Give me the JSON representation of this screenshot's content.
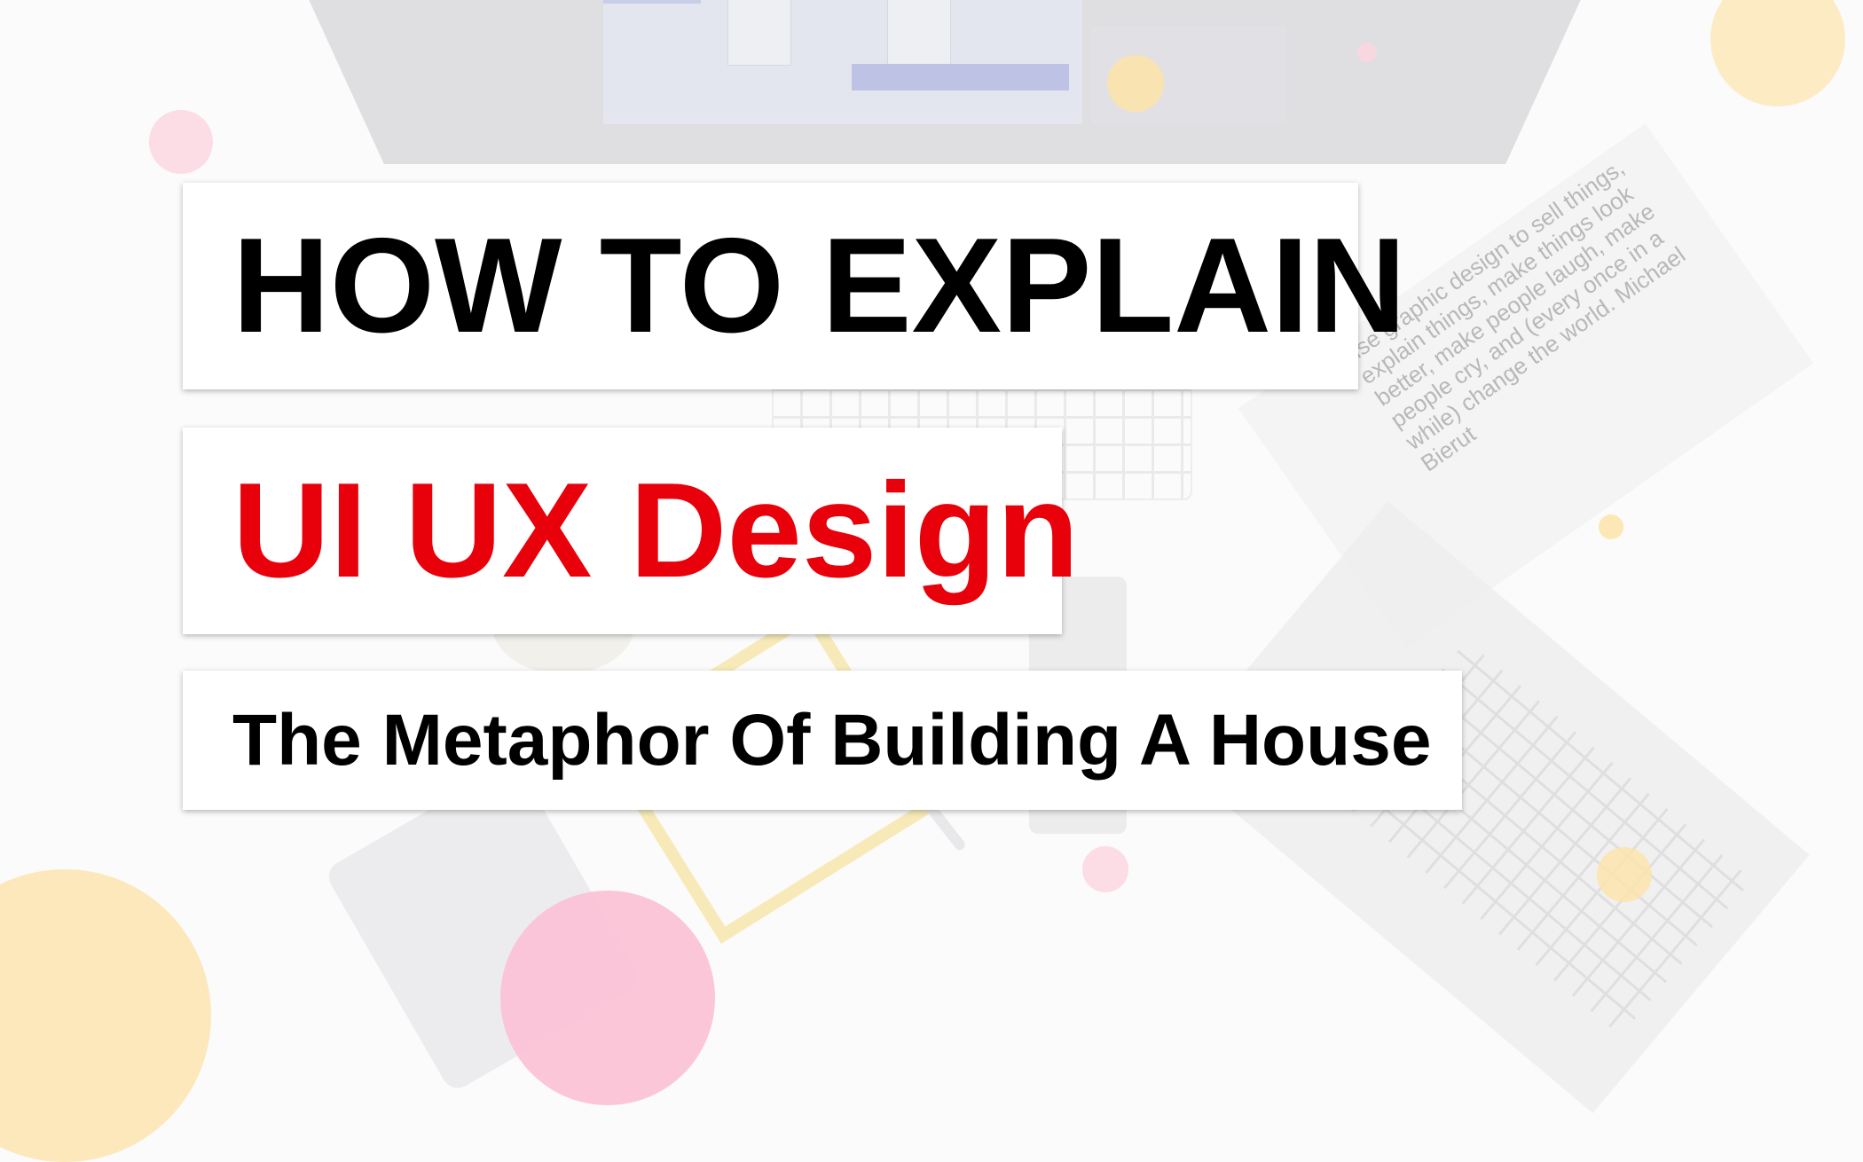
{
  "headline": {
    "line1": "HOW TO EXPLAIN",
    "line2": "UI UX Design",
    "subtitle": "The Metaphor Of Building A House"
  },
  "background": {
    "book_text": "use graphic design to sell things, explain things, make things look better, make people laugh, make people cry, and (every once in a while) change the world. Michael Bierut"
  },
  "colors": {
    "accent_red": "#e8000b",
    "text_black": "#000000",
    "box_white": "#ffffff",
    "dot_pink": "#fbc3d6",
    "dot_yellow": "#fde7b8"
  }
}
